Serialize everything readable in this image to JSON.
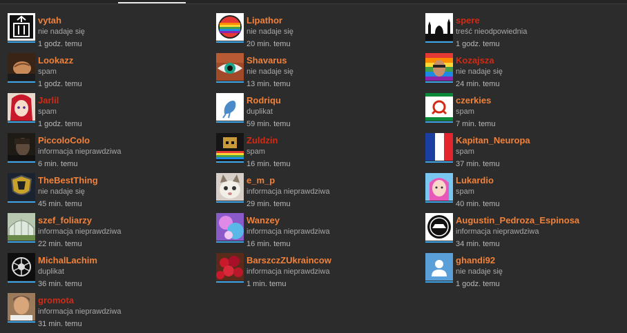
{
  "columns": [
    [
      {
        "username": "vytah",
        "reason": "nie nadaje się",
        "time": "1 godz. temu",
        "name_color": "orange",
        "avatar_icon": "elevator-icon"
      },
      {
        "username": "Lookazz",
        "reason": "spam",
        "time": "1 godz. temu",
        "name_color": "orange",
        "avatar_icon": "fist-avatar-icon"
      },
      {
        "username": "Jarlil",
        "reason": "spam",
        "time": "1 godz. temu",
        "name_color": "red",
        "avatar_icon": "anime-girl-avatar-icon"
      },
      {
        "username": "PiccoloColo",
        "reason": "informacja nieprawdziwa",
        "time": "6 min. temu",
        "name_color": "orange",
        "avatar_icon": "dark-portrait-avatar-icon"
      },
      {
        "username": "TheBestThing",
        "reason": "nie nadaje się",
        "time": "45 min. temu",
        "name_color": "orange",
        "avatar_icon": "shield-emblem-icon"
      },
      {
        "username": "szef_foliarzy",
        "reason": "informacja nieprawdziwa",
        "time": "22 min. temu",
        "name_color": "orange",
        "avatar_icon": "greenhouse-avatar-icon"
      },
      {
        "username": "MichalLachim",
        "reason": "duplikat",
        "time": "36 min. temu",
        "name_color": "orange",
        "avatar_icon": "ornament-emblem-icon"
      },
      {
        "username": "gromota",
        "reason": "informacja nieprawdziwa",
        "time": "31 min. temu",
        "name_color": "red",
        "avatar_icon": "man-portrait-avatar-icon"
      }
    ],
    [
      {
        "username": "Lipathor",
        "reason": "nie nadaje się",
        "time": "20 min. temu",
        "name_color": "orange",
        "avatar_icon": "rainbow-badge-icon"
      },
      {
        "username": "Shavarus",
        "reason": "nie nadaje się",
        "time": "13 min. temu",
        "name_color": "orange",
        "avatar_icon": "eye-avatar-icon"
      },
      {
        "username": "Rodriqu",
        "reason": "duplikat",
        "time": "59 min. temu",
        "name_color": "orange",
        "avatar_icon": "blue-creature-icon"
      },
      {
        "username": "Zuldzin",
        "reason": "spam",
        "time": "16 min. temu",
        "name_color": "red",
        "avatar_icon": "pixel-character-icon"
      },
      {
        "username": "e_m_p",
        "reason": "informacja nieprawdziwa",
        "time": "29 min. temu",
        "name_color": "orange",
        "avatar_icon": "cat-avatar-icon"
      },
      {
        "username": "Wanzey",
        "reason": "informacja nieprawdziwa",
        "time": "16 min. temu",
        "name_color": "orange",
        "avatar_icon": "purple-art-avatar-icon"
      },
      {
        "username": "BarszczZUkraincow",
        "reason": "informacja nieprawdziwa",
        "time": "1 min. temu",
        "name_color": "orange",
        "avatar_icon": "berries-avatar-icon"
      }
    ],
    [
      {
        "username": "spere",
        "reason": "treść nieodpowiednia",
        "time": "1 godz. temu",
        "name_color": "red",
        "avatar_icon": "skyline-silhouette-icon"
      },
      {
        "username": "Kozajsza",
        "reason": "nie nadaje się",
        "time": "24 min. temu",
        "name_color": "red",
        "avatar_icon": "rainbow-portrait-avatar-icon"
      },
      {
        "username": "czerkies",
        "reason": "spam",
        "time": "7 min. temu",
        "name_color": "orange",
        "avatar_icon": "ingush-flag-icon"
      },
      {
        "username": "Kapitan_Neuropa",
        "reason": "spam",
        "time": "37 min. temu",
        "name_color": "orange",
        "avatar_icon": "french-flag-icon"
      },
      {
        "username": "Lukardio",
        "reason": "spam",
        "time": "40 min. temu",
        "name_color": "orange",
        "avatar_icon": "pink-character-avatar-icon"
      },
      {
        "username": "Augustin_Pedroza_Espinosa",
        "reason": "informacja nieprawdziwa",
        "time": "34 min. temu",
        "name_color": "orange",
        "avatar_icon": "circle-emblem-icon"
      },
      {
        "username": "ghandi92",
        "reason": "nie nadaje się",
        "time": "1 godz. temu",
        "name_color": "orange",
        "avatar_icon": "default-user-icon"
      }
    ]
  ],
  "colors": {
    "background": "#2c2c2c",
    "username_orange": "#f2813a",
    "username_red": "#d32a14",
    "meta_text": "#a9a9a9",
    "avatar_bar": "#3ea6e8"
  }
}
